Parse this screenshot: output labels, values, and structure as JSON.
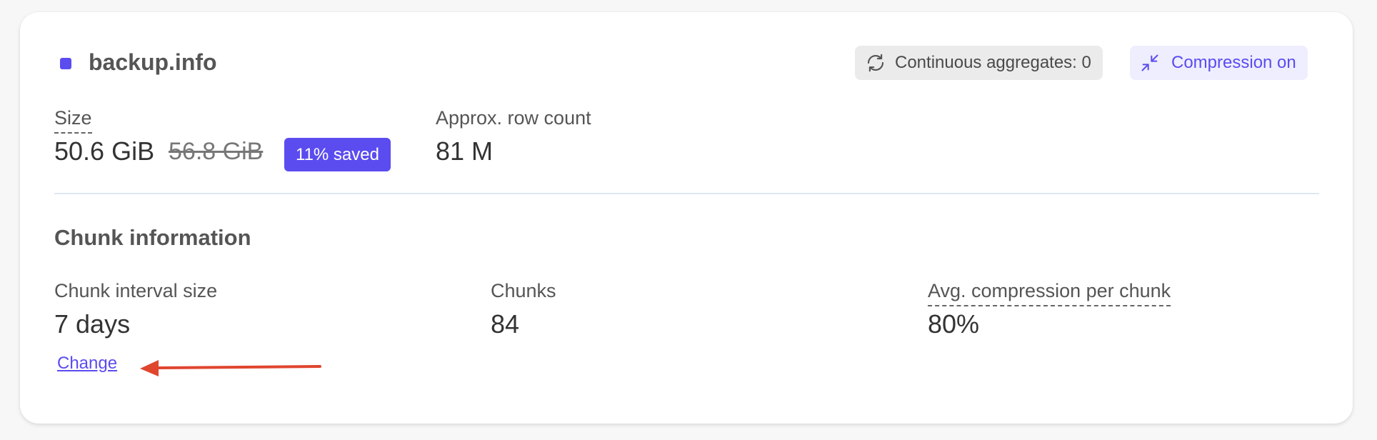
{
  "table": {
    "name": "backup.info",
    "dot_color": "#5b4cf0"
  },
  "badges": {
    "continuous_aggregates": {
      "label": "Continuous aggregates: 0",
      "icon": "refresh-icon",
      "bg": "#ebebeb",
      "color": "#4a4a4a"
    },
    "compression": {
      "label": "Compression on",
      "icon": "compress-icon",
      "bg": "#eeeefe",
      "color": "#5b4cf0"
    }
  },
  "size": {
    "label": "Size",
    "current": "50.6 GiB",
    "original": "56.8 GiB",
    "saved": "11% saved",
    "saved_bg": "#5b4cf0"
  },
  "rows": {
    "label": "Approx. row count",
    "value": "81 M"
  },
  "chunk_info": {
    "title": "Chunk information",
    "interval": {
      "label": "Chunk interval size",
      "value": "7 days"
    },
    "chunks": {
      "label": "Chunks",
      "value": "84"
    },
    "avg_compression": {
      "label": "Avg. compression per chunk",
      "value": "80%"
    },
    "change_link": "Change",
    "link_color": "#5b4cf0"
  },
  "annotation": {
    "arrow_color": "#e0452e"
  }
}
